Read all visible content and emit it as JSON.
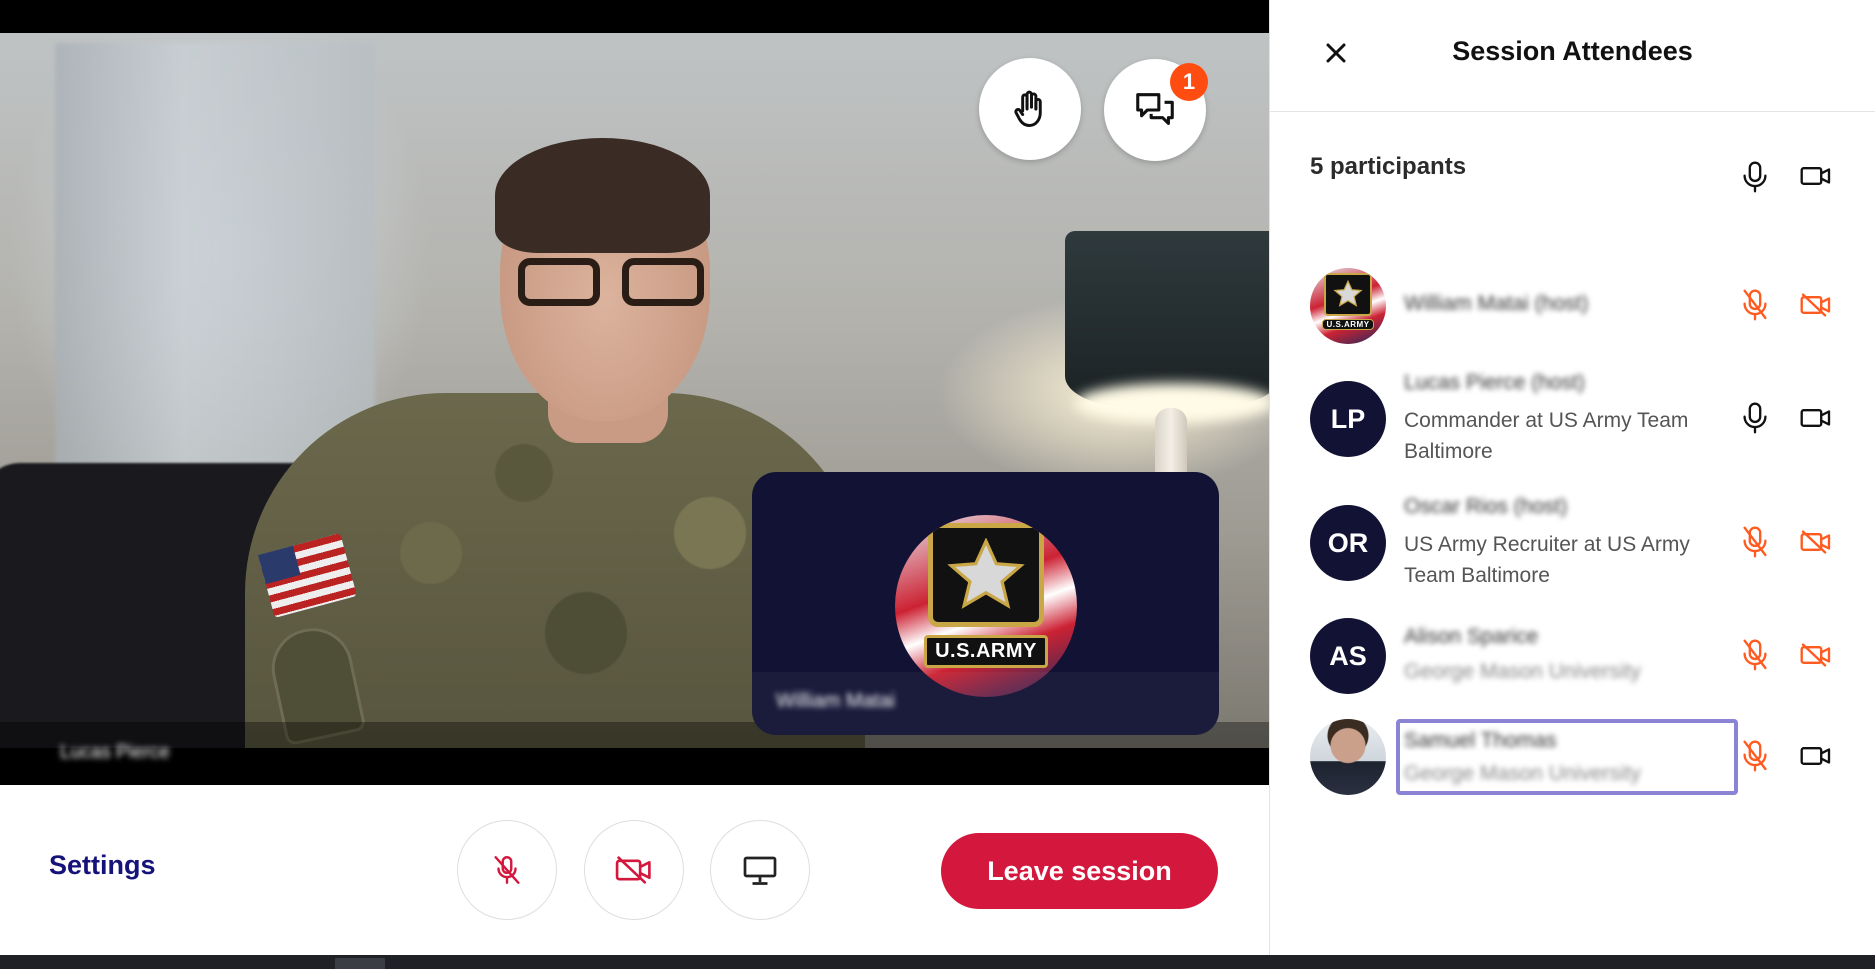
{
  "stage": {
    "main_participant_name": "Lucas Pierce",
    "pip_participant_name": "William Matai",
    "pip_logo_text": "U.S.ARMY",
    "chat_unread_count": "1"
  },
  "controls": {
    "settings_label": "Settings",
    "leave_label": "Leave session"
  },
  "panel": {
    "title": "Session Attendees",
    "participant_count_label": "5 participants",
    "attendees": [
      {
        "name": "William Matai (host)",
        "subtitle": "",
        "avatar_type": "logo",
        "avatar_text": "U.S.ARMY",
        "mic": "muted",
        "camera": "off"
      },
      {
        "name": "Lucas Pierce (host)",
        "subtitle": "Commander at US Army Team Baltimore",
        "avatar_type": "initials",
        "avatar_text": "LP",
        "mic": "on",
        "camera": "on"
      },
      {
        "name": "Oscar Rios (host)",
        "subtitle": "US Army Recruiter at US Army Team Baltimore",
        "avatar_type": "initials",
        "avatar_text": "OR",
        "mic": "muted",
        "camera": "off"
      },
      {
        "name": "Alison Sparice",
        "subtitle": "George Mason University",
        "avatar_type": "initials",
        "avatar_text": "AS",
        "mic": "muted",
        "camera": "off"
      },
      {
        "name": "Samuel Thomas",
        "subtitle": "George Mason University",
        "avatar_type": "photo",
        "avatar_text": "",
        "mic": "muted",
        "camera": "on"
      }
    ]
  },
  "colors": {
    "navy": "#121235",
    "leave_red": "#d3173d",
    "muted_orange": "#ff5a1f",
    "badge_orange": "#ff4d12",
    "settings_text": "#15127a",
    "focus_ring": "#8a83d6"
  },
  "icons": {
    "close": "close-icon",
    "raise_hand": "hand-icon",
    "chat": "chat-bubbles-icon",
    "mic": "microphone-icon",
    "mic_muted": "microphone-off-icon",
    "camera": "video-camera-icon",
    "camera_off": "video-camera-off-icon",
    "share": "monitor-icon"
  }
}
